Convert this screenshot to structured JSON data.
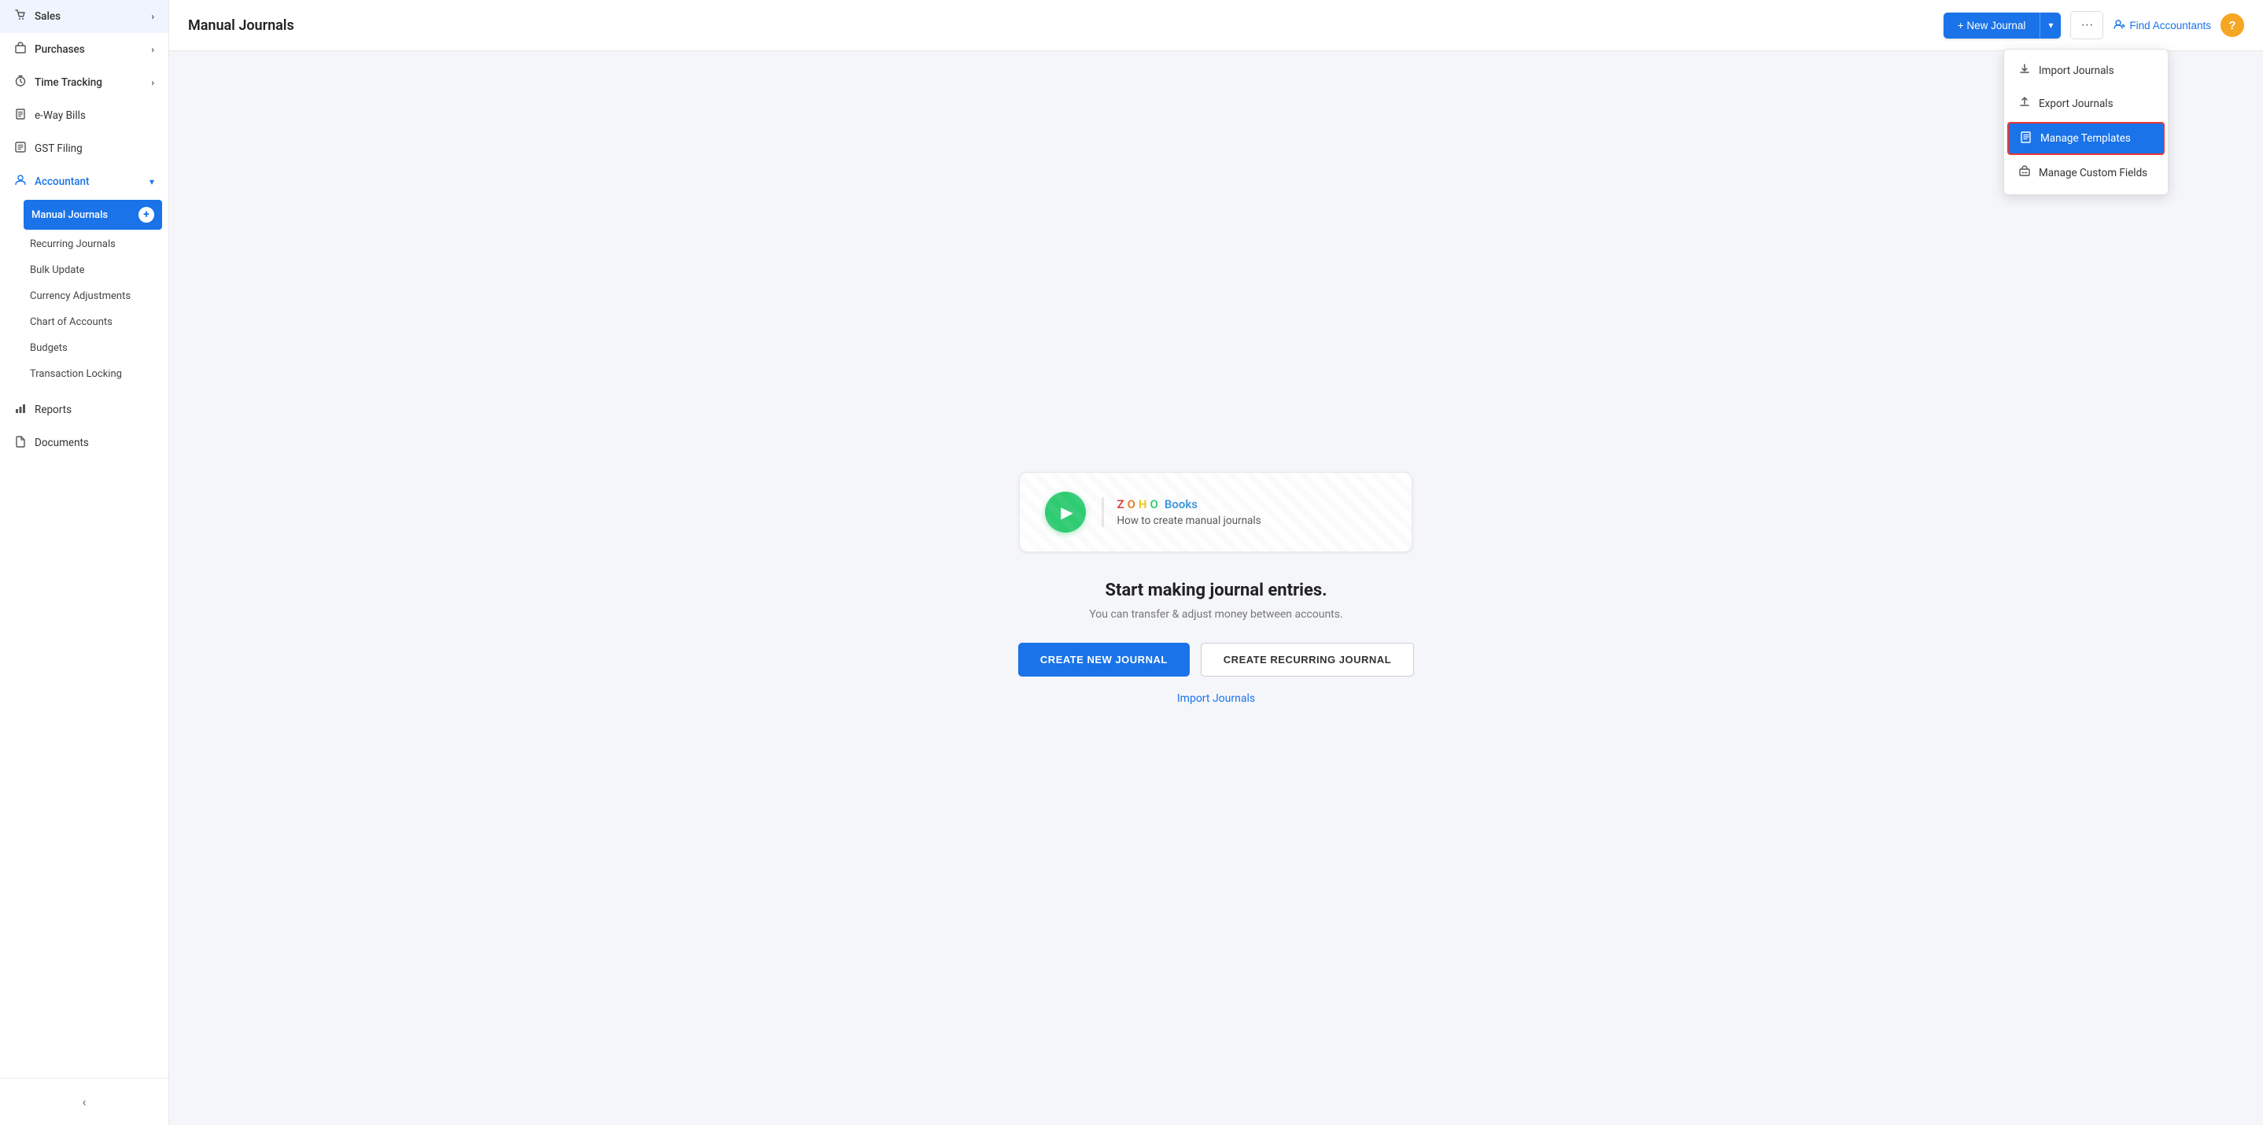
{
  "sidebar": {
    "items": [
      {
        "id": "sales",
        "label": "Sales",
        "icon": "🛒",
        "hasArrow": true
      },
      {
        "id": "purchases",
        "label": "Purchases",
        "icon": "🛍️",
        "hasArrow": true
      },
      {
        "id": "time-tracking",
        "label": "Time Tracking",
        "icon": "⏰",
        "hasArrow": true
      },
      {
        "id": "eway-bills",
        "label": "e-Way Bills",
        "icon": "🏷️",
        "hasArrow": false
      },
      {
        "id": "gst-filing",
        "label": "GST Filing",
        "icon": "📋",
        "hasArrow": false
      },
      {
        "id": "accountant",
        "label": "Accountant",
        "icon": "👤",
        "hasArrow": true,
        "expanded": true
      },
      {
        "id": "reports",
        "label": "Reports",
        "icon": "📊",
        "hasArrow": false
      },
      {
        "id": "documents",
        "label": "Documents",
        "icon": "📂",
        "hasArrow": false
      }
    ],
    "accountant_subitems": [
      {
        "id": "manual-journals",
        "label": "Manual Journals",
        "active": true
      },
      {
        "id": "recurring-journals",
        "label": "Recurring Journals"
      },
      {
        "id": "bulk-update",
        "label": "Bulk Update"
      },
      {
        "id": "currency-adjustments",
        "label": "Currency Adjustments"
      },
      {
        "id": "chart-of-accounts",
        "label": "Chart of Accounts"
      },
      {
        "id": "budgets",
        "label": "Budgets"
      },
      {
        "id": "transaction-locking",
        "label": "Transaction Locking"
      }
    ],
    "collapse_label": "‹"
  },
  "header": {
    "title": "Manual Journals",
    "new_journal_label": "+ New Journal",
    "more_icon": "···",
    "find_accountants_label": "Find Accountants",
    "help_label": "?"
  },
  "dropdown_menu": {
    "items": [
      {
        "id": "import-journals",
        "label": "Import Journals",
        "icon": "⬇️",
        "highlighted": false
      },
      {
        "id": "export-journals",
        "label": "Export Journals",
        "icon": "⬆️",
        "highlighted": false
      },
      {
        "id": "manage-templates",
        "label": "Manage Templates",
        "icon": "📄",
        "highlighted": true
      },
      {
        "id": "manage-custom-fields",
        "label": "Manage Custom Fields",
        "icon": "🔧",
        "highlighted": false
      }
    ]
  },
  "empty_state": {
    "video_brand": "ZOHO Books",
    "video_description": "How to create manual journals",
    "title": "Start making journal entries.",
    "subtitle": "You can transfer & adjust money between accounts.",
    "create_journal_label": "CREATE NEW JOURNAL",
    "create_recurring_label": "CREATE RECURRING JOURNAL",
    "import_link_label": "Import Journals"
  }
}
